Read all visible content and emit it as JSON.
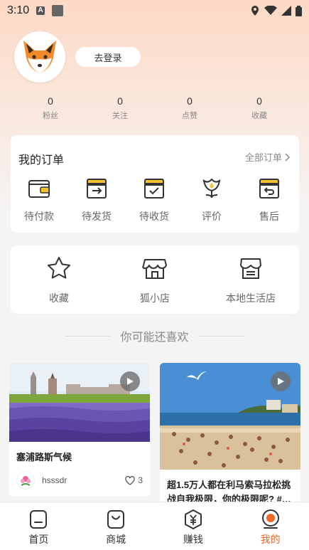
{
  "status_bar": {
    "time": "3:10"
  },
  "profile": {
    "login_label": "去登录"
  },
  "stats": [
    {
      "value": "0",
      "label": "粉丝"
    },
    {
      "value": "0",
      "label": "关注"
    },
    {
      "value": "0",
      "label": "点赞"
    },
    {
      "value": "0",
      "label": "收藏"
    }
  ],
  "orders": {
    "title": "我的订单",
    "all_label": "全部订单",
    "items": [
      {
        "label": "待付款",
        "icon": "wallet-icon"
      },
      {
        "label": "待发货",
        "icon": "ship-box-icon"
      },
      {
        "label": "待收货",
        "icon": "receive-box-icon"
      },
      {
        "label": "评价",
        "icon": "flower-icon"
      },
      {
        "label": "售后",
        "icon": "return-box-icon"
      }
    ]
  },
  "services": [
    {
      "label": "收藏",
      "icon": "star-icon"
    },
    {
      "label": "狐小店",
      "icon": "store-icon"
    },
    {
      "label": "本地生活店",
      "icon": "local-shop-icon"
    }
  ],
  "recommend": {
    "title": "你可能还喜欢"
  },
  "feed": [
    {
      "title": "塞浦路斯气候",
      "author": "hsssdr",
      "likes": "3",
      "has_video": true
    },
    {
      "title": "超1.5万人都在利马索马拉松挑战自我极限，你的极限呢? #…",
      "has_video": true
    }
  ],
  "tabs": [
    {
      "label": "首页",
      "icon": "home-icon",
      "active": false
    },
    {
      "label": "商城",
      "icon": "shop-bag-icon",
      "active": false
    },
    {
      "label": "赚钱",
      "icon": "yen-coin-icon",
      "active": false
    },
    {
      "label": "我的",
      "icon": "me-icon",
      "active": true
    }
  ],
  "colors": {
    "accent": "#f06a2c",
    "header_gradient_top": "#fcd9c5"
  }
}
